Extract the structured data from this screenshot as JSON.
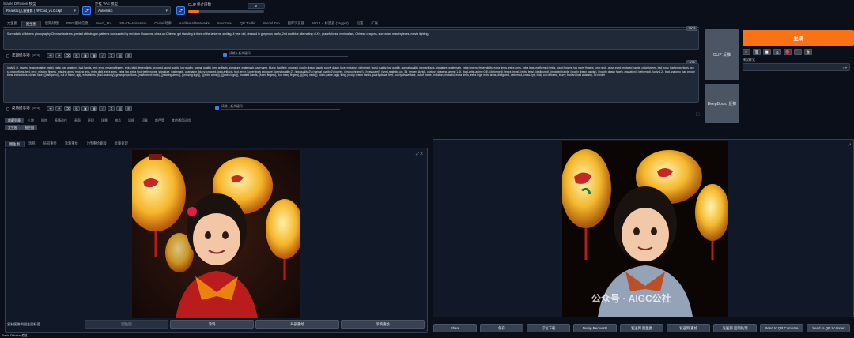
{
  "header": {
    "model_label": "Stable Diffusion 模型",
    "model_value": "Realistic|儿童摄影 | RPCkid_v1.0.ckpt",
    "vae_label": "外挂 VAE 模型",
    "vae_value": "Automatic",
    "clip_label": "CLIP 终止层数",
    "clip_value": "2",
    "clip_fill": 0.15
  },
  "main_tabs": [
    "文生图",
    "图生图",
    "后期处理",
    "PNG 图片信息",
    "mov2_Pro",
    "SD-CN-Animation",
    "Civitai 助手",
    "Additional Networks",
    "mov2mov",
    "QR Toolkit",
    "Model Zoo",
    "图库浏览器",
    "WD 1.4 标签器 (Tagger)",
    "设置",
    "扩展"
  ],
  "main_tab_active": 1,
  "prompt": {
    "text": "Surrealistic children's photography:Chinese lanterns, printed with dragon patterns surrounded by red plum blossoms, close-up:Chinese girl standing in front of the lanterns, smiling, 4 year old, dressed in gorgeous hanfu, 2nd and blue alternating <LX>, gracefulness, minimalism, Chinese dragons, surrealism masterpieces, movie lighting",
    "counter": "78/75"
  },
  "prompt_toolbar": {
    "label": "正面提示词",
    "count": "(0/75)",
    "input_placeholder": "请输入新关键词",
    "icons": [
      "⟲",
      "⟳",
      "⌫",
      "⎘",
      "▣",
      "▦",
      "✓",
      "⌗",
      "▤",
      "⊞"
    ]
  },
  "negative": {
    "text": "(ugly:0.4), lowres, (easynegative, nsfw), nsfw, bad anatomy, bad hands, text, error, missing fingers, extra digit, fewer digits, cropped, worst quality, low quality, normal quality, jpeg artifacts, signature, watermark, username, blurry, bad feet, cropped, poorly drawn hands, poorly drawn face, mutation, deformed, worst quality, low quality, normal quality, jpeg artifacts, signature, watermark, extra fingers, fewer digits, extra limbs, extra arms, extra legs, malformed limbs, fused fingers, too many fingers, long neck, cross-eyed, mutated hands, polar lowres, bad body, bad proportions, gross proportions, text, error, missing fingers, missing arms, missing legs, extra digit, extra arms, extra leg, extra foot, teethcroppe, signature, watermark, username, blurry, cropped, jpeg artifacts, text, error, Lower body exposure, (worst quality:2), (low quality:2), (normal quality:2), lowres, ((monochrome)), ((grayscale)), (semi-realistic, cgi, 3d, render, sketch, cartoon, drawing, anime:1.4), (bad-artist-anime:0.5), (deformed), (extra limbs), (extra legs), (disfigured), (mutated hands, (poorly drawn hands)), ((poorly drawn face)), (mutation), (deformed), (ugly:1.2), bad anatomy, bad proportions, extra limbs, cloned face, ((disfigured)), out of frame, ugly, extra limbs, (bad anatomy), gross proportions, (malformed limbs), ((missing arms)), ((missing legs)), (((extra arms))), (((extra legs))), mutated hands, (fused fingers), (too many fingers), (((long neck))), video game, ugly, tiling, poorly drawn hands, poorly drawn feet, poorly drawn face, out of frame, mutation, mutated, extra limbs, extra legs, extra arms, disfigured, deformed, cross-eye, body out of frame, blurry, bad art, bad anatomy, 3d render",
    "counter": "0/75"
  },
  "neg_toolbar": {
    "label": "反向提示词",
    "count": "(0/75)",
    "input_placeholder": "请输入新关键词"
  },
  "side_buttons": {
    "clip": "CLIP 反推",
    "deepbooru": "DeepBooru 反推"
  },
  "generate": {
    "label": "生成",
    "style_label": "预设样式",
    "icons": [
      "↙",
      "🗑",
      "📋",
      "◘",
      "🔴",
      "⬛",
      "🔒"
    ]
  },
  "keyword_tabs": [
    "收藏列表",
    "人物",
    "服饰",
    "表情动作",
    "画面",
    "环境",
    "场景",
    "物品",
    "风格",
    "印象",
    "颜色等",
    "其他通用词组"
  ],
  "keyword_subtabs": [
    "文生图",
    "图生图"
  ],
  "sub_tabs": [
    "图生图",
    "涂鸦",
    "局部重绘",
    "涂鸦重绘",
    "上传重绘蒙版",
    "批量处理"
  ],
  "sub_tab_active": 0,
  "left_footer": {
    "label": "复制图像到图生图标签",
    "buttons": [
      "图生图",
      "涂鸦",
      "局部重绘",
      "涂鸦重绘"
    ]
  },
  "bottom_buttons": [
    "Share",
    "保存",
    "打包下载",
    "Dump Requests",
    "发送到 图生图",
    "发送到 重绘",
    "发送到 后期处理",
    "Send to QR Compare",
    "Send to QR Scanner"
  ],
  "watermark": "公众号 · AIGC公社",
  "top_left_title": "Stable Diffusion 模型"
}
